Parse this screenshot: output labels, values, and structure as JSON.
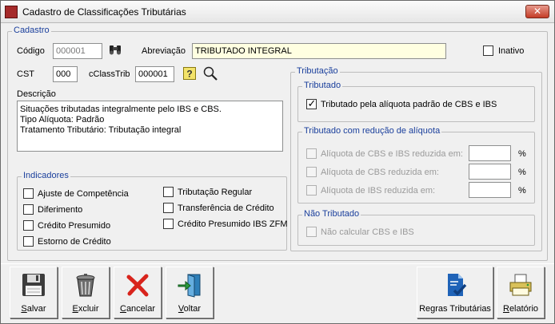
{
  "window": {
    "title": "Cadastro de Classificações Tributárias",
    "close_glyph": "✕"
  },
  "cadastro": {
    "legend": "Cadastro",
    "codigo_label": "Código",
    "codigo_value": "000001",
    "abreviacao_label": "Abreviação",
    "abreviacao_value": "TRIBUTADO INTEGRAL",
    "inativo_label": "Inativo",
    "cst_label": "CST",
    "cst_value": "000",
    "cclasstrib_label": "cClassTrib",
    "cclasstrib_value": "000001",
    "descricao_label": "Descrição",
    "descricao_lines": [
      "Situações tributadas integralmente pelo IBS e CBS.",
      "Tipo Alíquota: Padrão",
      "Tratamento Tributário: Tributação integral"
    ]
  },
  "indicadores": {
    "legend": "Indicadores",
    "items": [
      "Ajuste de Competência",
      "Diferimento",
      "Crédito Presumido",
      "Estorno de Crédito",
      "Tributação Regular",
      "Transferência de Crédito",
      "Crédito Presumido IBS ZFM"
    ]
  },
  "tributacao": {
    "legend": "Tributação",
    "tributado": {
      "legend": "Tributado",
      "checkbox_label": "Tributado pela alíquota padrão de CBS e IBS",
      "checked": true
    },
    "reducao": {
      "legend": "Tributado com redução de alíquota",
      "items": [
        {
          "label": "Alíquota de CBS e IBS reduzida em:",
          "percent": "%"
        },
        {
          "label": "Alíquota de CBS reduzida em:",
          "percent": "%"
        },
        {
          "label": "Alíquota de IBS reduzida em:",
          "percent": "%"
        }
      ]
    },
    "nao_tributado": {
      "legend": "Não Tributado",
      "checkbox_label": "Não calcular CBS e IBS"
    }
  },
  "toolbar": {
    "salvar": {
      "accel": "S",
      "rest": "alvar"
    },
    "excluir": {
      "accel": "E",
      "rest": "xcluir"
    },
    "cancelar": {
      "accel": "C",
      "rest": "ancelar"
    },
    "voltar": {
      "accel": "V",
      "rest": "oltar"
    },
    "regras": {
      "label": "Regras Tributárias"
    },
    "relatorio": {
      "accel": "R",
      "rest": "elatório"
    }
  },
  "check_glyph": "✓",
  "colors": {
    "legend_blue": "#1a3f9c",
    "abbrev_bg": "#ffffe1",
    "cancel_red": "#d8241c"
  }
}
